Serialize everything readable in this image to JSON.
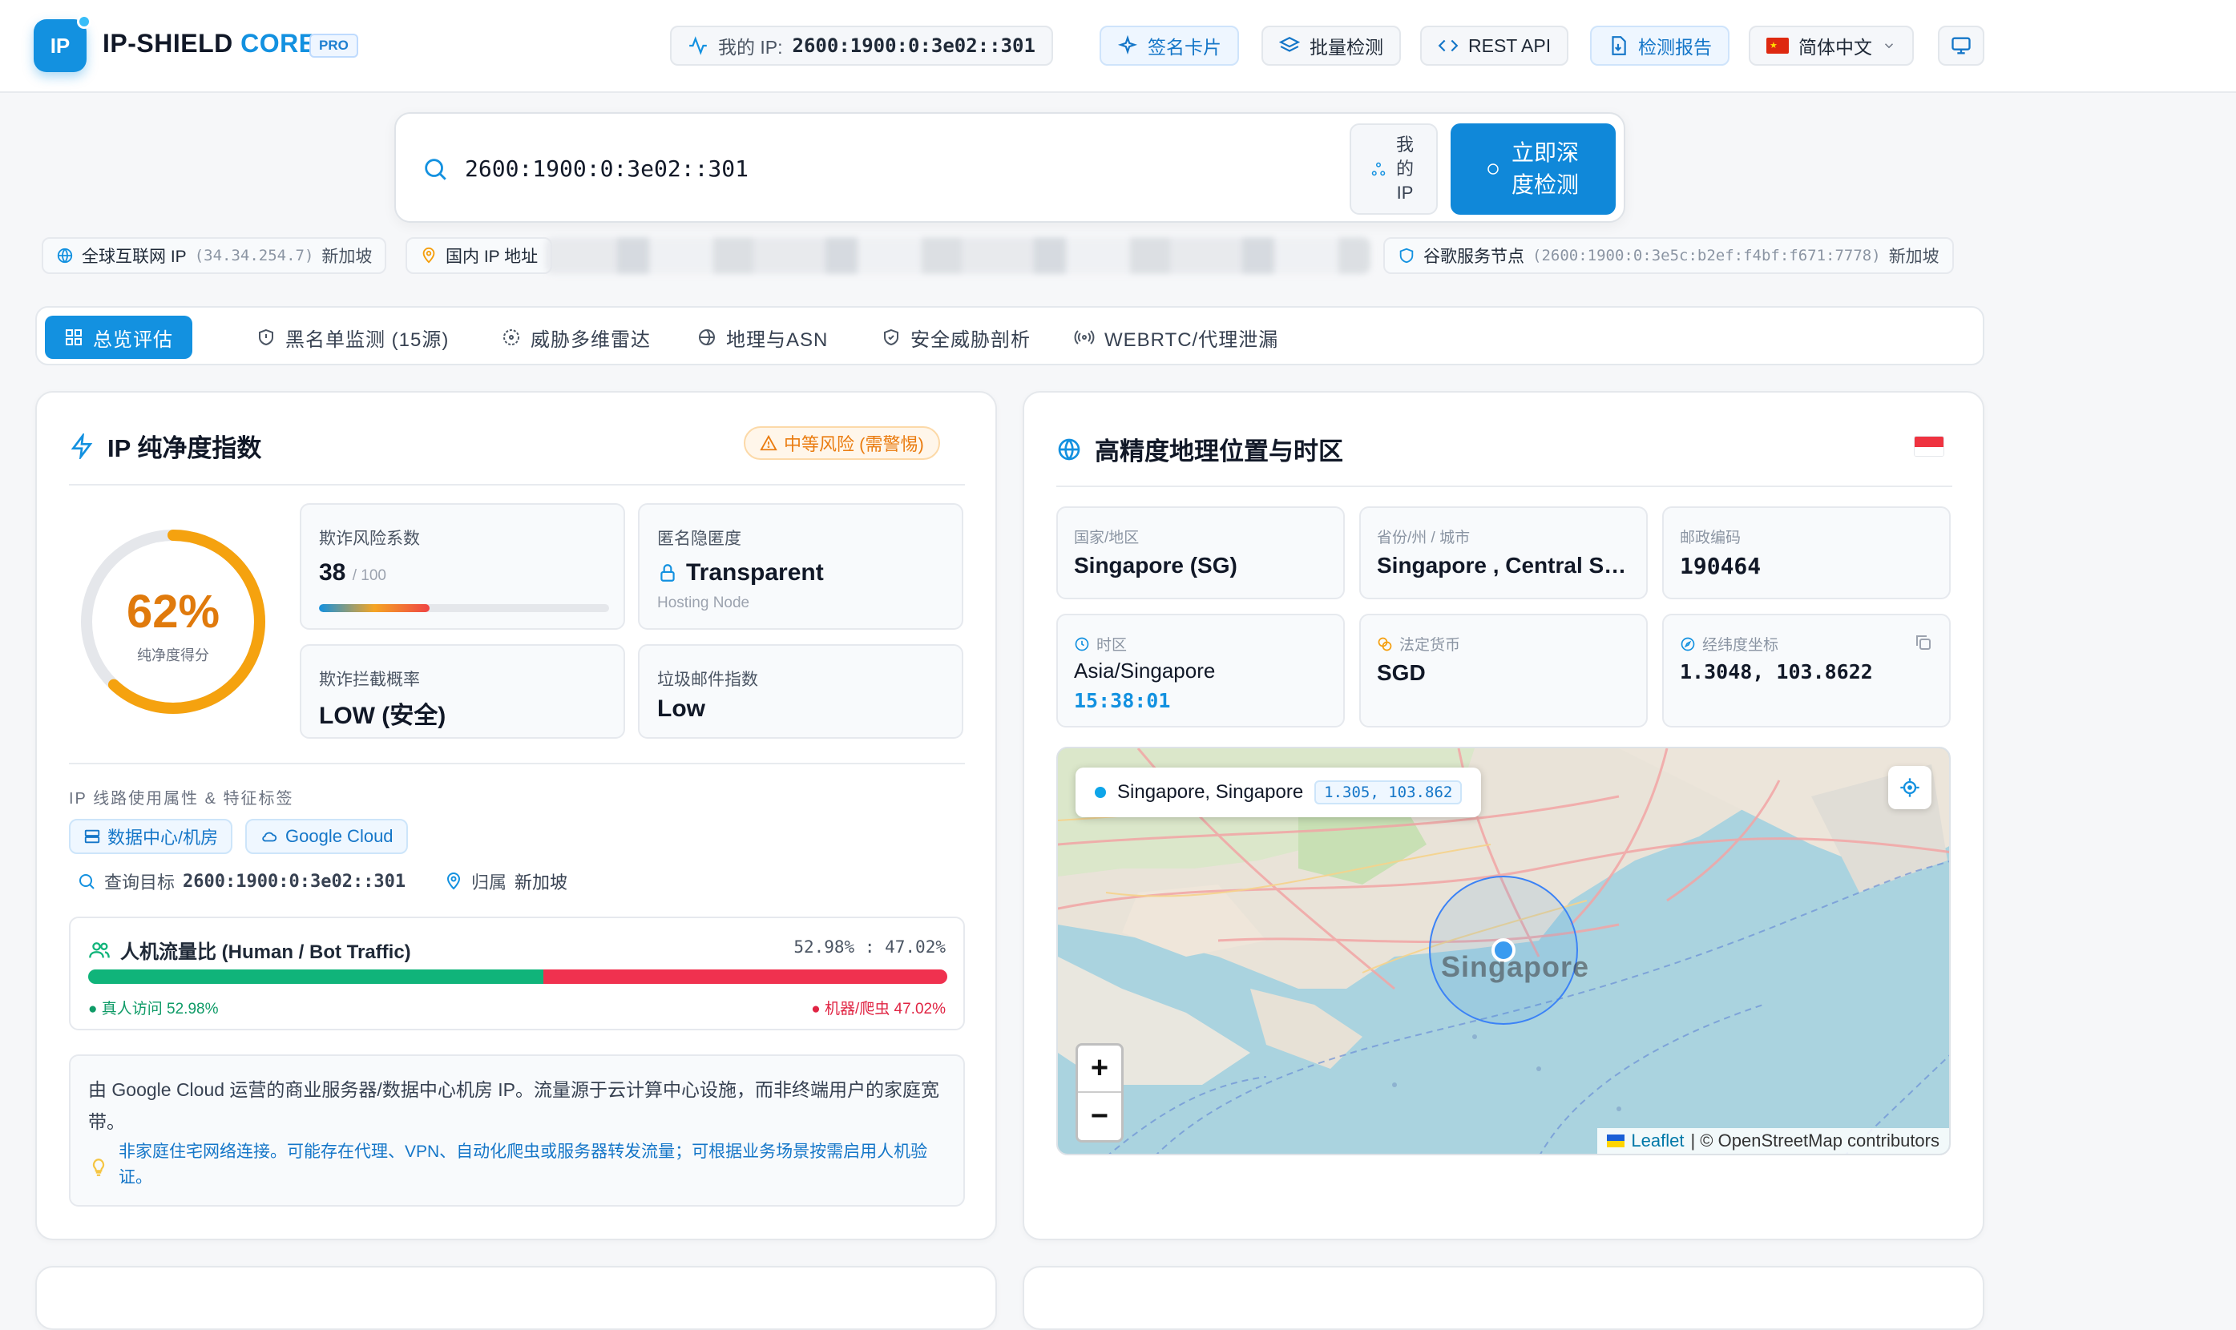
{
  "header": {
    "logo_text": "IP",
    "brand_main": "IP-SHIELD ",
    "brand_accent": "CORE",
    "pro_badge": "PRO",
    "my_ip_label": "我的 IP:",
    "my_ip_value": "2600:1900:0:3e02::301",
    "signature_card": "签名卡片",
    "batch_check": "批量检测",
    "rest_api": "REST API",
    "report": "检测报告",
    "language": "简体中文"
  },
  "search": {
    "value": "2600:1900:0:3e02::301",
    "my_ip_button": "我的IP",
    "detect_button": "立即深度检测"
  },
  "chips": {
    "global": {
      "label": "全球互联网 IP",
      "ip": "(34.34.254.7)",
      "location": "新加坡"
    },
    "domestic": {
      "label": "国内 IP 地址"
    },
    "google": {
      "label": "谷歌服务节点",
      "ip": "(2600:1900:0:3e5c:b2ef:f4bf:f671:7778)",
      "location": "新加坡"
    }
  },
  "tabs": [
    {
      "label": "总览评估"
    },
    {
      "label": "黑名单监测 (15源)"
    },
    {
      "label": "威胁多维雷达"
    },
    {
      "label": "地理与ASN"
    },
    {
      "label": "安全威胁剖析"
    },
    {
      "label": "WEBRTC/代理泄漏"
    }
  ],
  "purity": {
    "title": "IP 纯净度指数",
    "risk_badge": "中等风险 (需警惕)",
    "score_text": "62%",
    "score": 62,
    "score_label": "纯净度得分",
    "fraud_label": "欺诈风险系数",
    "fraud_value": "38",
    "fraud_max": "/ 100",
    "fraud_level": 0.38,
    "anon_label": "匿名隐匿度",
    "anon_value": "Transparent",
    "anon_sub": "Hosting Node",
    "block_label": "欺诈拦截概率",
    "block_value": "LOW (安全)",
    "spam_label": "垃圾邮件指数",
    "spam_value": "Low",
    "attr_label": "IP 线路使用属性 & 特征标签",
    "tag_dc": "数据中心/机房",
    "tag_gc": "Google Cloud",
    "query_label": "查询目标",
    "query_value": "2600:1900:0:3e02::301",
    "owner_label": "归属",
    "owner_value": "新加坡",
    "traffic_title": "人机流量比 (Human / Bot Traffic)",
    "traffic_ratio": "52.98% : 47.02%",
    "human_pct": 52.98,
    "human_legend": "● 真人访问 52.98%",
    "bot_legend": "● 机器/爬虫 47.02%",
    "desc_main": "由 Google Cloud 运营的商业服务器/数据中心机房 IP。流量源于云计算中心设施，而非终端用户的家庭宽带。",
    "desc_note": "非家庭住宅网络连接。可能存在代理、VPN、自动化爬虫或服务器转发流量；可根据业务场景按需启用人机验证。"
  },
  "geo": {
    "title": "高精度地理位置与时区",
    "country_label": "国家/地区",
    "country_value": "Singapore (SG)",
    "region_label": "省份/州 / 城市",
    "region_value": "Singapore , Central Singapore",
    "postal_label": "邮政编码",
    "postal_value": "190464",
    "tz_label": "时区",
    "tz_value": "Asia/Singapore",
    "tz_time": "15:38:01",
    "currency_label": "法定货币",
    "currency_value": "SGD",
    "coord_label": "经纬度坐标",
    "coord_value": "1.3048, 103.8622",
    "map_popup": "Singapore, Singapore",
    "map_coord": "1.305, 103.862",
    "map_city": "Singapore",
    "attrib_leaflet": "Leaflet",
    "attrib_osm": "| © OpenStreetMap contributors"
  },
  "colors": {
    "accent": "#1391e0",
    "warning": "#f59e0b",
    "human": "#10b47a",
    "bot": "#f0314f"
  }
}
